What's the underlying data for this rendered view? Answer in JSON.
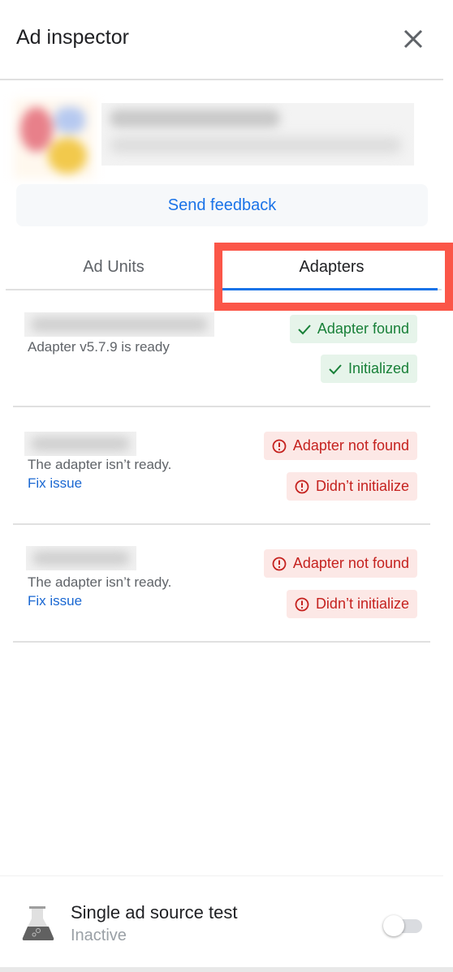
{
  "header": {
    "title": "Ad inspector",
    "close_icon": "close-icon"
  },
  "app": {
    "icon": "app-icon-blurred",
    "name": "",
    "id": ""
  },
  "feedback_button": "Send feedback",
  "tabs": [
    {
      "label": "Ad Units",
      "selected": false
    },
    {
      "label": "Adapters",
      "selected": true
    }
  ],
  "adapters": [
    {
      "name": "",
      "description": "Adapter v5.7.9 is ready",
      "fix_link": null,
      "badges": [
        {
          "icon": "check-icon",
          "label": "Adapter found",
          "status": "success"
        },
        {
          "icon": "check-icon",
          "label": "Initialized",
          "status": "success"
        }
      ]
    },
    {
      "name": "",
      "description": "The adapter isn’t ready.",
      "fix_link": "Fix issue",
      "badges": [
        {
          "icon": "error-icon",
          "label": "Adapter not found",
          "status": "error"
        },
        {
          "icon": "error-icon",
          "label": "Didn’t initialize",
          "status": "error"
        }
      ]
    },
    {
      "name": "",
      "description": "The adapter isn’t ready.",
      "fix_link": "Fix issue",
      "badges": [
        {
          "icon": "error-icon",
          "label": "Adapter not found",
          "status": "error"
        },
        {
          "icon": "error-icon",
          "label": "Didn’t initialize",
          "status": "error"
        }
      ]
    }
  ],
  "single_ad_source_test": {
    "icon": "flask-icon",
    "title": "Single ad source test",
    "status": "Inactive",
    "enabled": false
  },
  "colors": {
    "accent": "#1a73e8",
    "success_text": "#188038",
    "success_bg": "#e6f4ea",
    "error_text": "#c5221f",
    "error_bg": "#fce8e6",
    "highlight": "#fb5648"
  }
}
